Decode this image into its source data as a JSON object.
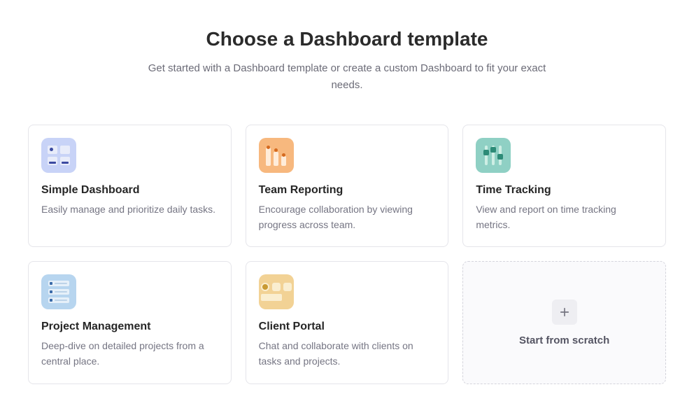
{
  "header": {
    "title": "Choose a Dashboard template",
    "subtitle": "Get started with a Dashboard template or create a custom Dashboard to fit your exact needs."
  },
  "templates": [
    {
      "title": "Simple Dashboard",
      "desc": "Easily manage and prioritize daily tasks.",
      "icon_semantic": "simple-dashboard-icon"
    },
    {
      "title": "Team Reporting",
      "desc": "Encourage collaboration by viewing progress across team.",
      "icon_semantic": "team-reporting-icon"
    },
    {
      "title": "Time Tracking",
      "desc": "View and report on time tracking metrics.",
      "icon_semantic": "time-tracking-icon"
    },
    {
      "title": "Project Management",
      "desc": "Deep-dive on detailed projects from a central place.",
      "icon_semantic": "project-management-icon"
    },
    {
      "title": "Client Portal",
      "desc": "Chat and collaborate with clients on tasks and projects.",
      "icon_semantic": "client-portal-icon"
    }
  ],
  "scratch": {
    "label": "Start from scratch"
  }
}
